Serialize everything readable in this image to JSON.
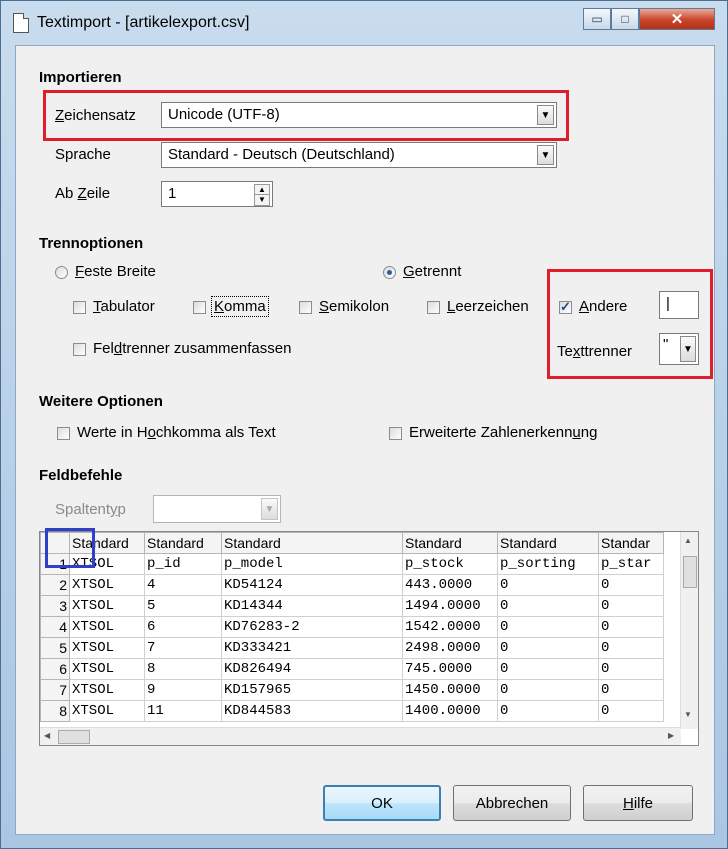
{
  "window": {
    "title": "Textimport - [artikelexport.csv]",
    "minimize_glyph": "▭",
    "maximize_glyph": "□",
    "close_glyph": "✕"
  },
  "import": {
    "section": "Importieren",
    "charset_label_prefix": "",
    "charset_label_mnemonic": "Z",
    "charset_label_rest": "eichensatz",
    "charset_value": "Unicode (UTF-8)",
    "language_label": "Sprache",
    "language_value": "Standard - Deutsch (Deutschland)",
    "fromrow_label_pre": "Ab ",
    "fromrow_label_mnemonic": "Z",
    "fromrow_label_rest": "eile",
    "fromrow_value": "1"
  },
  "separator": {
    "section": "Trennoptionen",
    "fixed_width_m": "F",
    "fixed_width_rest": "este Breite",
    "separated_m": "G",
    "separated_rest": "etrennt",
    "tab_m": "T",
    "tab_rest": "abulator",
    "comma_m": "K",
    "comma_rest": "omma",
    "semicolon_m": "S",
    "semicolon_rest": "emikolon",
    "space_m": "L",
    "space_rest": "eerzeichen",
    "other_m": "A",
    "other_rest": "ndere",
    "other_value": "|",
    "merge_pre": "Fel",
    "merge_m": "d",
    "merge_rest": "trenner zusammenfassen",
    "quote_pre": "Te",
    "quote_m": "x",
    "quote_rest": "ttrenner",
    "quote_value": "\""
  },
  "other_options": {
    "section": "Weitere Optionen",
    "quoted_pre": "Werte in H",
    "quoted_m": "o",
    "quoted_rest": "chkomma als Text",
    "detect_pre": "Erweiterte Zahlenerkenn",
    "detect_m": "u",
    "detect_rest": "ng"
  },
  "fields": {
    "section": "Feldbefehle",
    "coltype_pre": "Spaltent",
    "coltype_m": "y",
    "coltype_rest": "p",
    "headers": [
      "Standard",
      "Standard",
      "Standard",
      "Standard",
      "Standard",
      "Standar"
    ],
    "rows": [
      {
        "n": "1",
        "c": [
          "XTSOL",
          "p_id",
          "p_model",
          "p_stock",
          "p_sorting",
          "p_star"
        ]
      },
      {
        "n": "2",
        "c": [
          "XTSOL",
          "4",
          "KD54124",
          "443.0000",
          "0",
          "0"
        ]
      },
      {
        "n": "3",
        "c": [
          "XTSOL",
          "5",
          "KD14344",
          "1494.0000",
          "0",
          "0"
        ]
      },
      {
        "n": "4",
        "c": [
          "XTSOL",
          "6",
          "KD76283-2",
          "1542.0000",
          "0",
          "0"
        ]
      },
      {
        "n": "5",
        "c": [
          "XTSOL",
          "7",
          "KD333421",
          "2498.0000",
          "0",
          "0"
        ]
      },
      {
        "n": "6",
        "c": [
          "XTSOL",
          "8",
          "KD826494",
          "745.0000",
          "0",
          "0"
        ]
      },
      {
        "n": "7",
        "c": [
          "XTSOL",
          "9",
          "KD157965",
          "1450.0000",
          "0",
          "0"
        ]
      },
      {
        "n": "8",
        "c": [
          "XTSOL",
          "11",
          "KD844583",
          "1400.0000",
          "0",
          "0"
        ]
      }
    ]
  },
  "buttons": {
    "ok": "OK",
    "cancel": "Abbrechen",
    "help_m": "H",
    "help_rest": "ilfe"
  },
  "colors": {
    "highlight_red": "#e01e2b",
    "highlight_blue": "#2f3fc9"
  }
}
